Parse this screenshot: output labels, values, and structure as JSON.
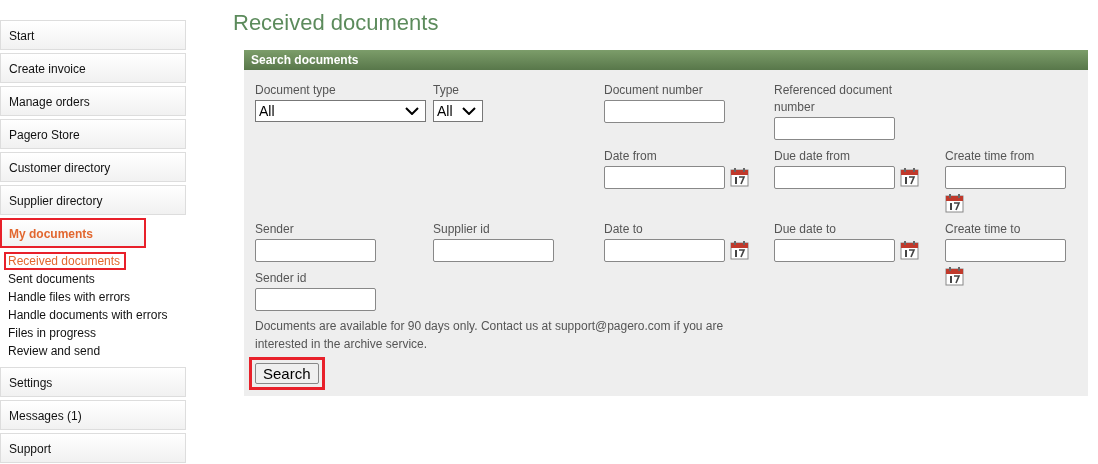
{
  "sidebar": {
    "items": [
      {
        "label": "Start",
        "selected": false,
        "highlighted": false
      },
      {
        "label": "Create invoice",
        "selected": false,
        "highlighted": false
      },
      {
        "label": "Manage orders",
        "selected": false,
        "highlighted": false
      },
      {
        "label": "Pagero Store",
        "selected": false,
        "highlighted": false
      },
      {
        "label": "Customer directory",
        "selected": false,
        "highlighted": false
      },
      {
        "label": "Supplier directory",
        "selected": false,
        "highlighted": false
      },
      {
        "label": "My documents",
        "selected": true,
        "highlighted": true,
        "children": [
          {
            "label": "Received documents",
            "selected": true,
            "highlighted": true
          },
          {
            "label": "Sent documents",
            "selected": false,
            "highlighted": false
          },
          {
            "label": "Handle files with errors",
            "selected": false,
            "highlighted": false
          },
          {
            "label": "Handle documents with errors",
            "selected": false,
            "highlighted": false
          },
          {
            "label": "Files in progress",
            "selected": false,
            "highlighted": false
          },
          {
            "label": "Review and send",
            "selected": false,
            "highlighted": false
          }
        ]
      },
      {
        "label": "Settings",
        "selected": false,
        "highlighted": false
      },
      {
        "label": "Messages (1)",
        "selected": false,
        "highlighted": false
      },
      {
        "label": "Support",
        "selected": false,
        "highlighted": false
      }
    ]
  },
  "page_title": "Received documents",
  "search_panel": {
    "title": "Search documents",
    "fields": [
      {
        "kind": "select",
        "label": "Document type",
        "value": "All"
      },
      {
        "kind": "select",
        "label": "Type",
        "value": "All"
      },
      {
        "kind": "text",
        "label": "Document number"
      },
      {
        "kind": "text",
        "label": "Referenced document number"
      },
      {
        "kind": "date",
        "label": "Date from"
      },
      {
        "kind": "date",
        "label": "Due date from"
      },
      {
        "kind": "date",
        "label": "Create time from"
      },
      {
        "kind": "text",
        "label": "Sender"
      },
      {
        "kind": "text",
        "label": "Supplier id"
      },
      {
        "kind": "date",
        "label": "Date to"
      },
      {
        "kind": "date",
        "label": "Due date to"
      },
      {
        "kind": "date",
        "label": "Create time to"
      },
      {
        "kind": "text",
        "label": "Sender id"
      }
    ],
    "note": "Documents are available for 90 days only. Contact us at support@pagero.com if you are interested in the archive service.",
    "search_button": {
      "label": "Search",
      "highlighted": true
    }
  }
}
